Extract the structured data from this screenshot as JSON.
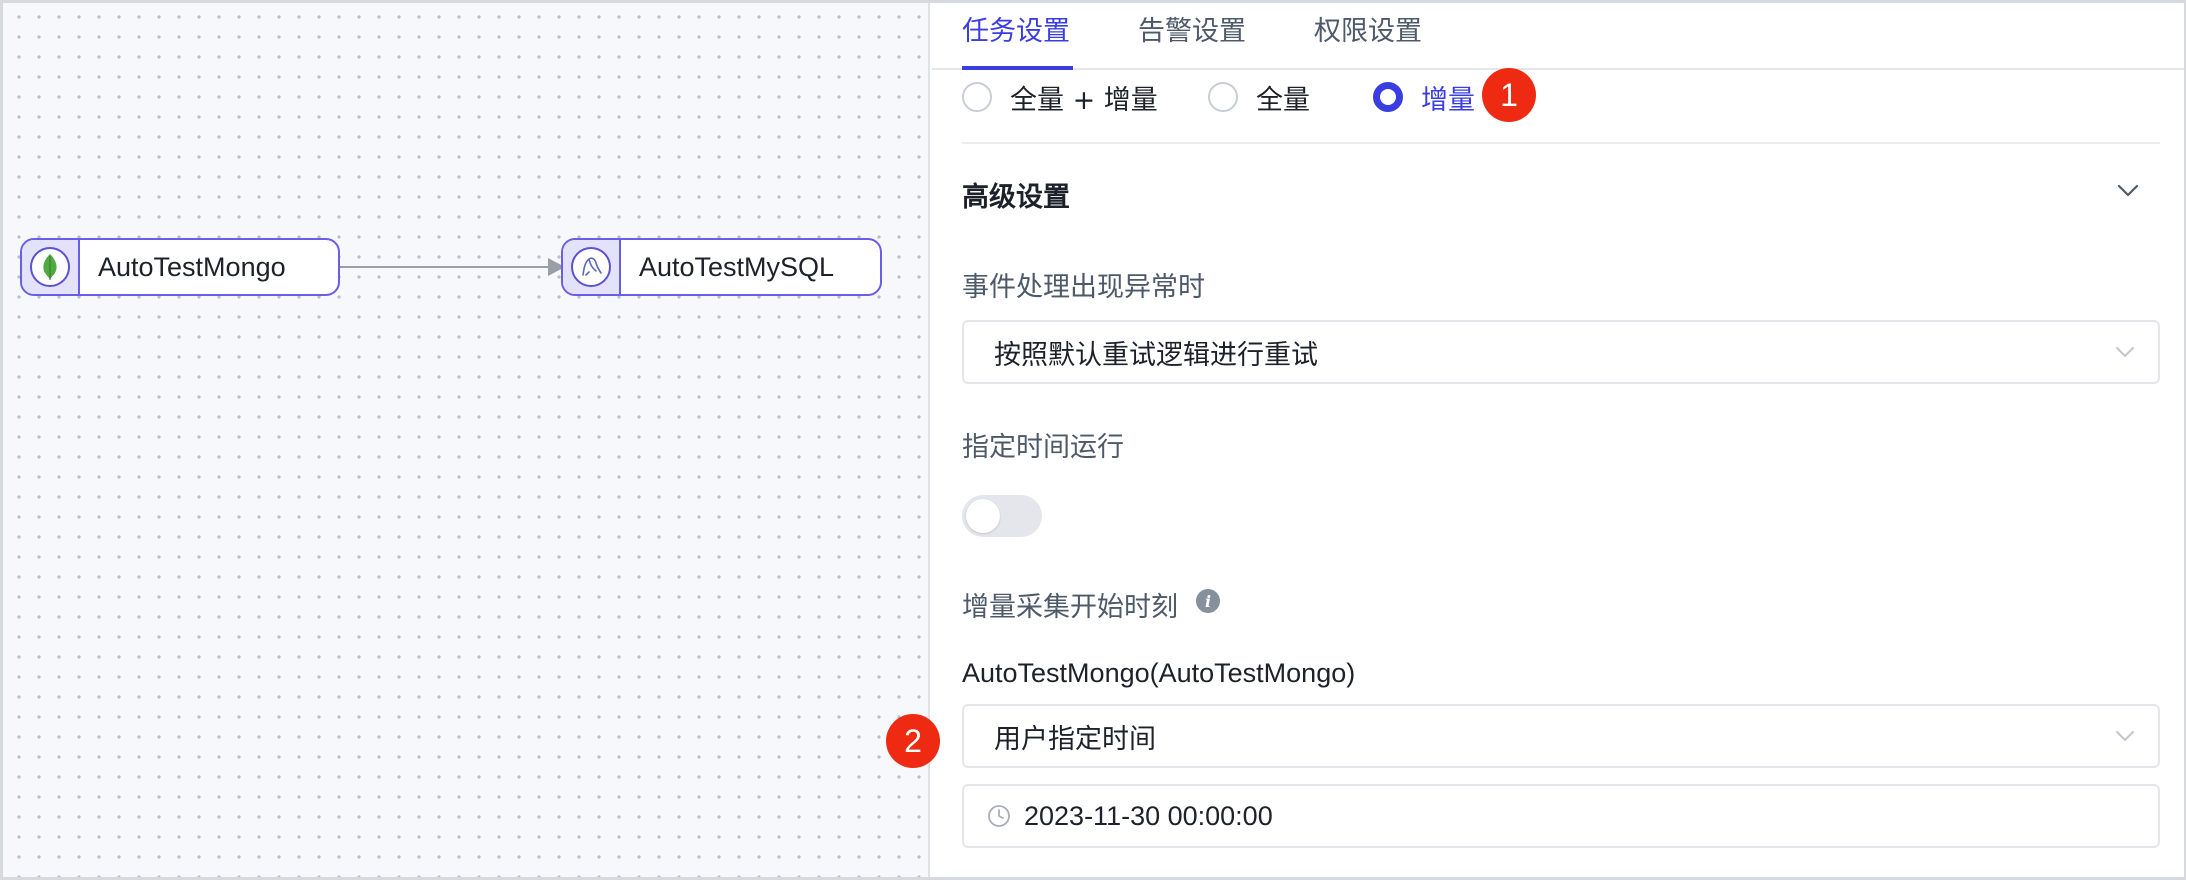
{
  "canvas": {
    "nodes": [
      {
        "label": "AutoTestMongo",
        "icon": "mongodb-leaf-icon"
      },
      {
        "label": "AutoTestMySQL",
        "icon": "mysql-dolphin-icon"
      }
    ]
  },
  "tabs": [
    {
      "label": "任务设置",
      "active": true
    },
    {
      "label": "告警设置",
      "active": false
    },
    {
      "label": "权限设置",
      "active": false
    }
  ],
  "sync_type": {
    "options": [
      "全量 + 增量",
      "全量",
      "增量"
    ],
    "selected": "增量"
  },
  "markers": [
    "1",
    "2"
  ],
  "advanced": {
    "title": "高级设置",
    "event_error_label": "事件处理出现异常时",
    "event_error_value": "按照默认重试逻辑进行重试",
    "scheduled_run_label": "指定时间运行",
    "scheduled_run_enabled": false,
    "incremental_start_label": "增量采集开始时刻",
    "info_glyph": "i",
    "source_label": "AutoTestMongo(AutoTestMongo)",
    "start_mode_value": "用户指定时间",
    "start_time_value": "2023-11-30 00:00:00"
  },
  "colors": {
    "accent": "#3a3ee0",
    "node_border": "#6a5de8",
    "marker": "#ee2a12"
  }
}
